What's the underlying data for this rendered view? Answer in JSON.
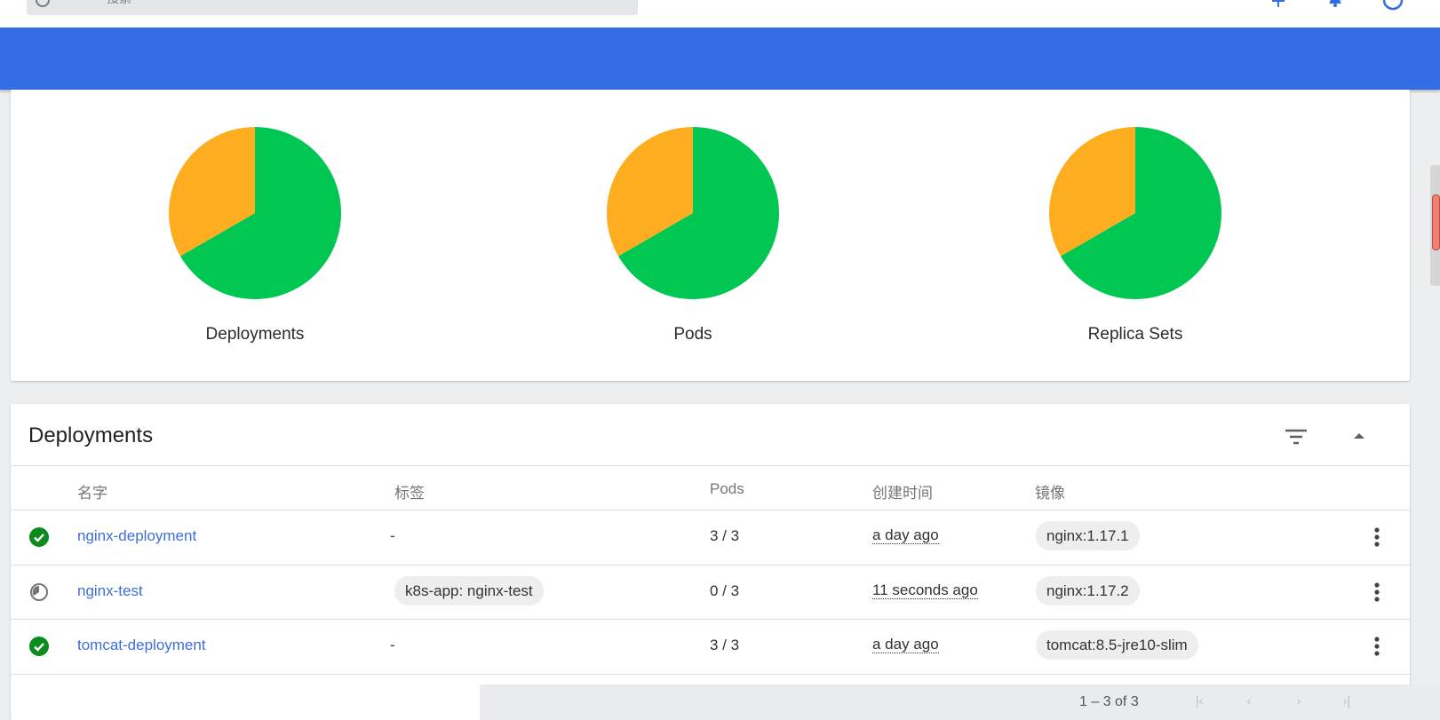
{
  "search": {
    "placeholder": "搜索"
  },
  "colors": {
    "accent": "#326de6",
    "running": "#00c752",
    "pending": "#ffad20",
    "link": "#3d6fd9"
  },
  "workloads": {
    "charts": [
      {
        "label": "Deployments",
        "slices": [
          {
            "status": "running",
            "value": 2,
            "color": "#00c752"
          },
          {
            "status": "pending",
            "value": 1,
            "color": "#ffad20"
          }
        ]
      },
      {
        "label": "Pods",
        "slices": [
          {
            "status": "running",
            "value": 6,
            "color": "#00c752"
          },
          {
            "status": "pending",
            "value": 3,
            "color": "#ffad20"
          }
        ]
      },
      {
        "label": "Replica Sets",
        "slices": [
          {
            "status": "running",
            "value": 2,
            "color": "#00c752"
          },
          {
            "status": "pending",
            "value": 1,
            "color": "#ffad20"
          }
        ]
      }
    ]
  },
  "chart_data": [
    {
      "type": "pie",
      "title": "Deployments",
      "categories": [
        "running",
        "pending"
      ],
      "values": [
        2,
        1
      ]
    },
    {
      "type": "pie",
      "title": "Pods",
      "categories": [
        "running",
        "pending"
      ],
      "values": [
        6,
        3
      ]
    },
    {
      "type": "pie",
      "title": "Replica Sets",
      "categories": [
        "running",
        "pending"
      ],
      "values": [
        2,
        1
      ]
    }
  ],
  "deployments": {
    "title": "Deployments",
    "filter_icon": "filter-icon",
    "collapse_icon": "chevron-up-icon",
    "columns": {
      "name": "名字",
      "labels": "标签",
      "pods": "Pods",
      "created": "创建时间",
      "images": "镜像"
    },
    "rows": [
      {
        "status": "ok",
        "name": "nginx-deployment",
        "labels": "-",
        "pods": "3 / 3",
        "created": "a day ago",
        "image": "nginx:1.17.1"
      },
      {
        "status": "pending",
        "name": "nginx-test",
        "labels": "k8s-app: nginx-test",
        "pods": "0 / 3",
        "created": "11 seconds ago",
        "image": "nginx:1.17.2"
      },
      {
        "status": "ok",
        "name": "tomcat-deployment",
        "labels": "-",
        "pods": "3 / 3",
        "created": "a day ago",
        "image": "tomcat:8.5-jre10-slim"
      }
    ]
  },
  "paginator": {
    "range": "1 – 3 of 3"
  }
}
